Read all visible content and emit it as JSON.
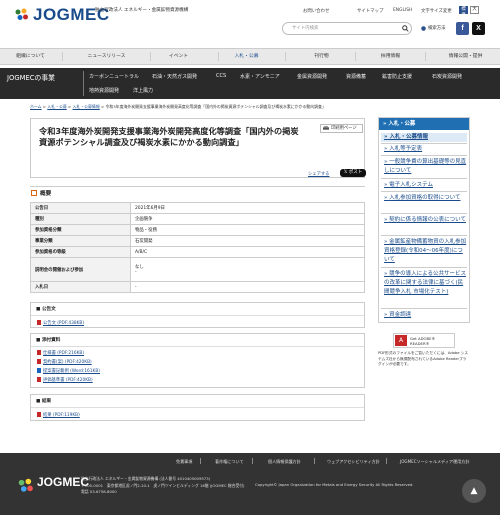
{
  "header": {
    "logo": "JOGMEC",
    "org_line1": "独立行政法人 エネルギー・金属鉱物資源機構",
    "util_links": [
      "お問い合わせ",
      "サイトマップ",
      "ENGLISH"
    ],
    "font_size_label": "文字サイズ変更",
    "font_sizes": [
      "標準",
      "大"
    ],
    "search_placeholder": "サイト内検索",
    "detail_search": "検索方法"
  },
  "global_nav": [
    "組織について",
    "ニュースリリース",
    "イベント",
    "入札・公募",
    "刊行物",
    "採用情報",
    "情報公開・提供"
  ],
  "sub_nav": {
    "title": "JOGMECの事業",
    "row1": [
      "カーボンニュートラル",
      "石油・天然ガス開発",
      "CCS",
      "水素・アンモニア",
      "金属資源開発",
      "資源備蓄",
      "鉱害防止支援",
      "石炭資源開発"
    ],
    "row2": [
      "地熱資源開発",
      "洋上風力"
    ]
  },
  "breadcrumb": {
    "items": [
      "ホーム",
      "入札・公募",
      "入札・公募情報"
    ],
    "current": "令和3年度海外炭開発支援事業海外炭開発高度化等調査「国内外の掲炭資源ポテンシャル調査及び褐炭水素にかかる動向調査」"
  },
  "page": {
    "title": "令和3年度海外炭開発支援事業海外炭開発高度化等調査「国内外の掲炭資源ポテンシャル調査及び褐炭水素にかかる動向調査」",
    "print": "印刷用ページ",
    "share": "シェアする",
    "tweet": "ポスト"
  },
  "overview": {
    "heading": "概要",
    "rows": [
      {
        "k": "公告日",
        "v": "2021年6月9日"
      },
      {
        "k": "種別",
        "v": "企画競争"
      },
      {
        "k": "参加資格分類",
        "v": "物品・役務"
      },
      {
        "k": "事業分類",
        "v": "石炭開発"
      },
      {
        "k": "参加資格の等級",
        "v": "A/B/C"
      },
      {
        "k": "説明会の開催および参加",
        "v": "なし"
      },
      {
        "k": "入札日",
        "v": "-"
      }
    ],
    "row6_sub": "-"
  },
  "notice": {
    "heading": "公告文",
    "files": [
      "公告文 (PDF:438KB)"
    ]
  },
  "attachments": {
    "heading": "添付資料",
    "files": [
      {
        "label": "仕様書 (PDF:216KB)",
        "type": "pdf"
      },
      {
        "label": "契約書(案) (PDF:420KB)",
        "type": "pdf"
      },
      {
        "label": "提案書記載例 (Word:161KB)",
        "type": "word"
      },
      {
        "label": "評価基準書 (PDF:420KB)",
        "type": "pdf"
      }
    ]
  },
  "result": {
    "heading": "結果",
    "files": [
      "結果 (PDF:119KB)"
    ]
  },
  "sidebar": {
    "heading": "入札・公募",
    "items": [
      {
        "label": "入札・公募情報",
        "selected": true
      },
      {
        "label": "入札等予定表",
        "selected": false
      },
      {
        "label": "一般競争費の算出基礎等の見直しについて",
        "selected": false
      },
      {
        "label": "電子入札システム",
        "selected": false
      },
      {
        "label": "入札参加資格の取得について",
        "selected": false
      },
      {
        "label": "契約に係る情報の公表について",
        "selected": false
      },
      {
        "label": "金属鉱産物備蓄物資の入札参加資格登録(令和04〜06年度)について",
        "selected": false
      },
      {
        "label": "競争の導入による公共サービスの改革に関する法律に基づく(民間競争入札 市場化テスト)",
        "selected": false
      },
      {
        "label": "資金調達",
        "selected": false
      }
    ],
    "adobe_badge": "Get ADOBE® READER®",
    "adobe_note": "PDF形式のファイルをご覧いただくには、Adobe システムズ社から無償配布されているAdobe Readerプラグインが必要です。"
  },
  "footer": {
    "links": [
      "免責事項",
      "著作権について",
      "個人情報保護方針",
      "ウェブアクセシビリティ方針",
      "JOGMECソーシャルメディア運用方針"
    ],
    "logo": "JOGMEC",
    "org": "独立行政法人 エネルギー・金属鉱物資源機構 (法人番号 4010405009573)",
    "address": "〒105-0001　東京都港区虎ノ門2-10-1　虎ノ門ツインビルディング 16階 (JOGMEC 総合受付)",
    "tel": "電話 03-6758-8000",
    "copyright": "Copyright© Japan Organization for Metals and Energy Security All Rights Reserved.",
    "to_top": "▲"
  },
  "colors": {
    "brand": "#1a4c8c",
    "sidebar_head": "#1f6fb2",
    "subnav_bg": "#2a2a2a",
    "footer_bg": "#333333"
  }
}
